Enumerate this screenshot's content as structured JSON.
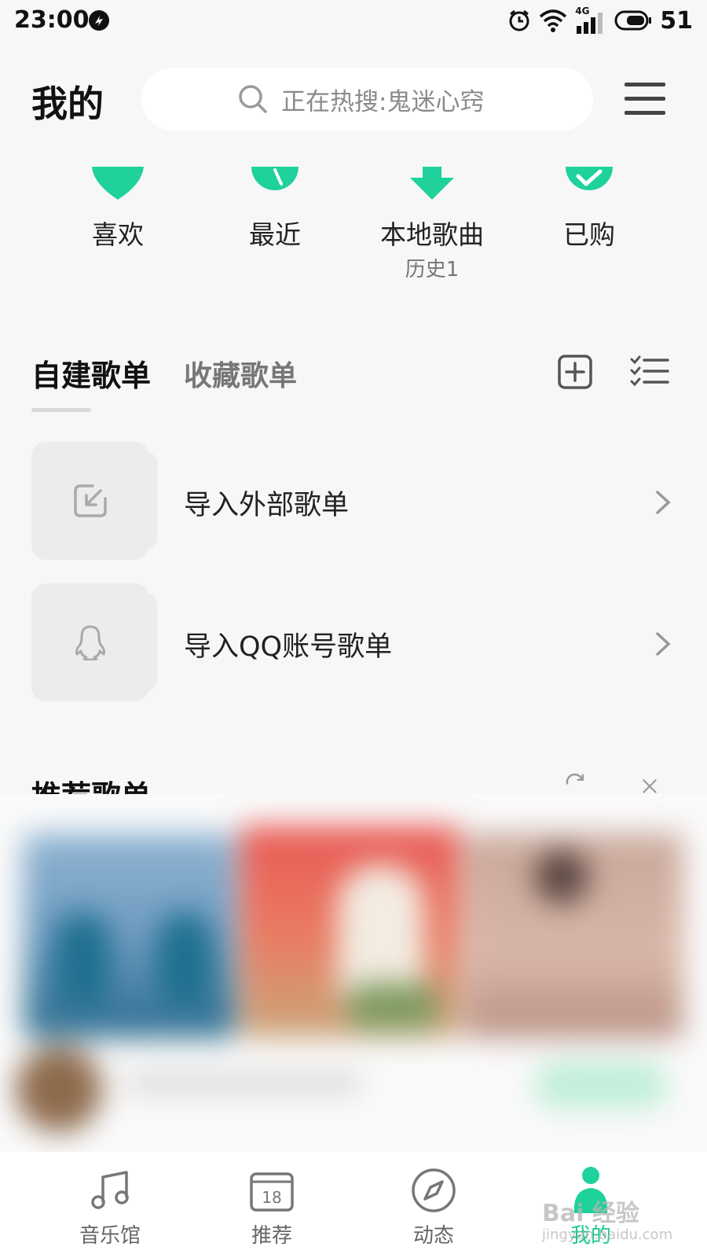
{
  "status_bar": {
    "time": "23:00",
    "network": "4G",
    "battery": "51"
  },
  "header": {
    "title": "我的",
    "search_placeholder": "正在热搜:鬼迷心窍"
  },
  "quick_entries": [
    {
      "label": "喜欢",
      "sub": ""
    },
    {
      "label": "最近",
      "sub": ""
    },
    {
      "label": "本地歌曲",
      "sub": "历史1"
    },
    {
      "label": "已购",
      "sub": ""
    }
  ],
  "playlist_tabs": {
    "own": "自建歌单",
    "favorite": "收藏歌单"
  },
  "import_rows": [
    {
      "label": "导入外部歌单"
    },
    {
      "label": "导入QQ账号歌单"
    }
  ],
  "recommended": {
    "title": "推荐歌单"
  },
  "bottom_nav": [
    {
      "label": "音乐馆"
    },
    {
      "label": "推荐",
      "icon_text": "18"
    },
    {
      "label": "动态"
    },
    {
      "label": "我的"
    }
  ],
  "watermark": {
    "text": "Bai 经验",
    "sub": "jingyan.baidu.com"
  },
  "colors": {
    "accent": "#1fc792",
    "background": "#f7f7f7"
  }
}
